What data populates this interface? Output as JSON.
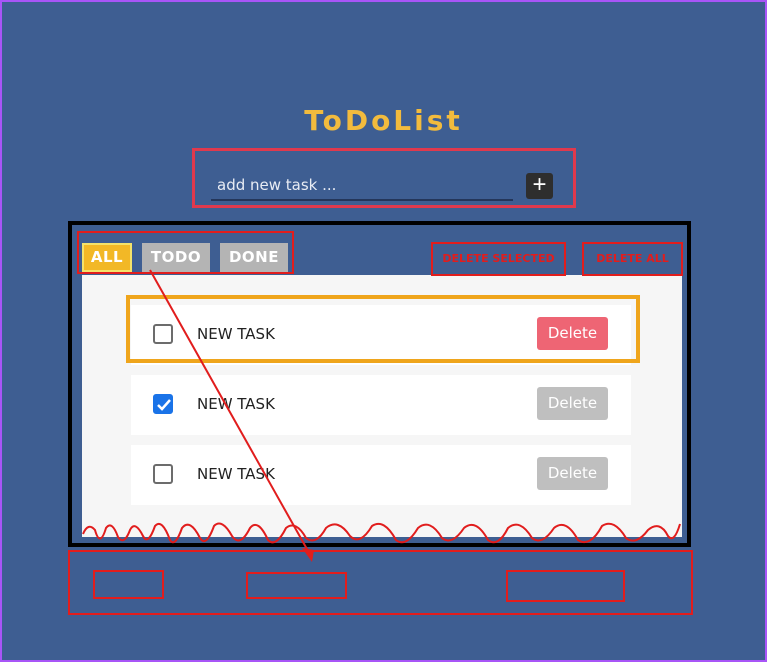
{
  "app": {
    "title": "ToDoList"
  },
  "input": {
    "placeholder": "add new task ...",
    "add_icon": "plus-icon"
  },
  "filters": {
    "all": "ALL",
    "todo": "TODO",
    "done": "DONE",
    "active": "ALL"
  },
  "actions": {
    "delete_selected": "DELETE SELECTED",
    "delete_all": "DELETE ALL"
  },
  "tasks": [
    {
      "label": "NEW TASK",
      "checked": false,
      "delete": "Delete"
    },
    {
      "label": "NEW TASK",
      "checked": true,
      "delete": "Delete"
    },
    {
      "label": "NEW TASK",
      "checked": false,
      "delete": "Delete"
    }
  ],
  "colors": {
    "background": "#3e5e92",
    "title": "#f2bb3d",
    "tab_active": "#f2b826",
    "tab_inactive": "#b4b4b4",
    "delete_active": "#ee6574",
    "delete_inactive": "#bfbfbf",
    "annotation_red": "#e11d1d",
    "annotation_orange": "#efa51c"
  }
}
